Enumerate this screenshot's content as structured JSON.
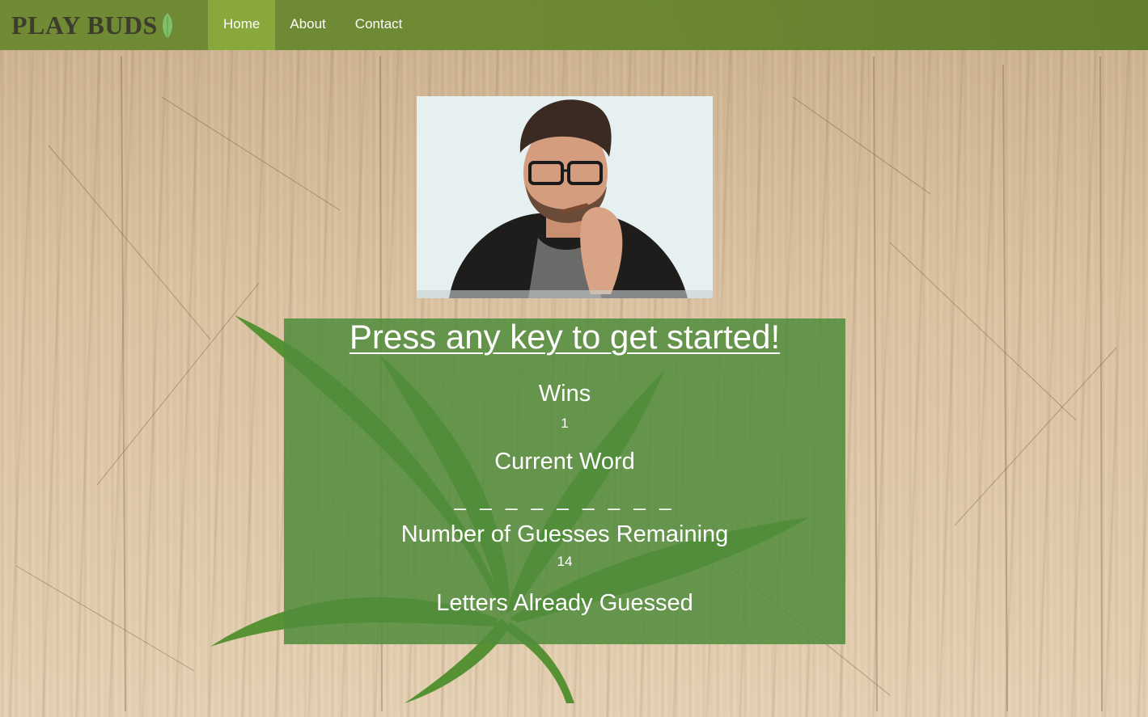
{
  "brand": {
    "name": "PLAY BUDS",
    "icon": "leaf-icon"
  },
  "nav": {
    "items": [
      {
        "label": "Home",
        "active": true
      },
      {
        "label": "About",
        "active": false
      },
      {
        "label": "Contact",
        "active": false
      }
    ]
  },
  "hero": {
    "image": "man-smoking-photo"
  },
  "game": {
    "prompt": "Press any key to get started!",
    "wins_label": "Wins",
    "wins_value": "1",
    "current_word_label": "Current Word",
    "current_word_value": "_ _ _ _ _ _ _ _ _",
    "guesses_label": "Number of Guesses Remaining",
    "guesses_value": "14",
    "letters_label": "Letters Already Guessed"
  },
  "colors": {
    "navbar": "#6e8a32",
    "nav_active": "#86a83a",
    "panel": "#508c3c"
  }
}
